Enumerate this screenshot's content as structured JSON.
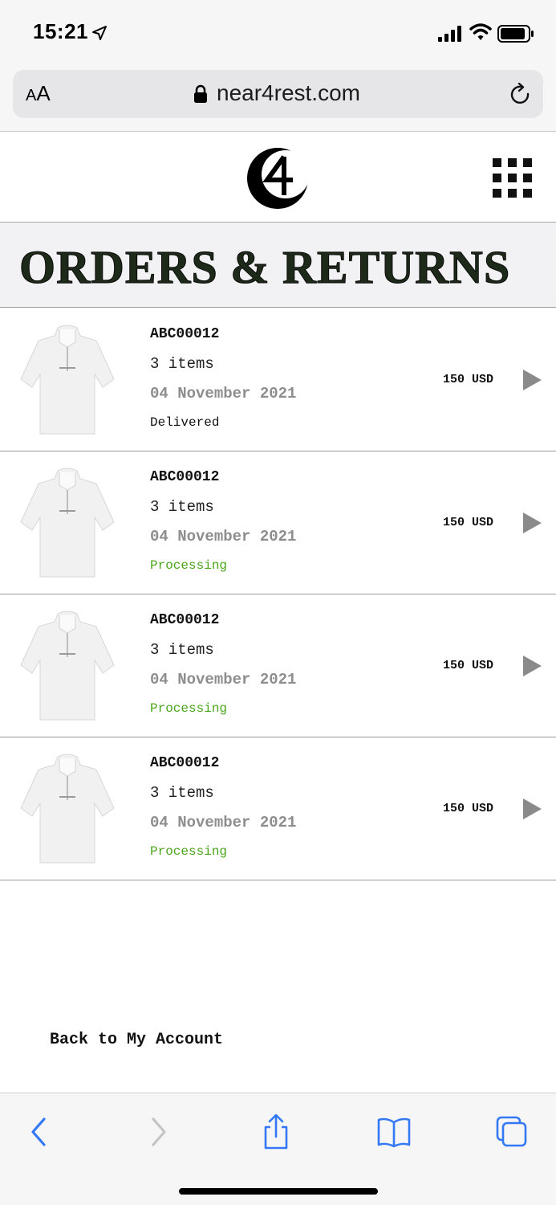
{
  "status_bar": {
    "time": "15:21",
    "icons": [
      "location-arrow-icon",
      "signal-bars-icon",
      "wifi-icon",
      "battery-icon"
    ]
  },
  "browser": {
    "text_size_label_small": "A",
    "text_size_label_large": "A",
    "url": "near4rest.com",
    "icons": [
      "lock-icon",
      "reload-icon"
    ]
  },
  "site_header": {
    "logo": "near4rest-logo-icon",
    "menu": "grid-menu-icon"
  },
  "page": {
    "title": "ORDERS & RETURNS"
  },
  "orders": [
    {
      "id": "ABC00012",
      "items": "3 items",
      "date": "04 November 2021",
      "status": "Delivered",
      "price": "150 USD"
    },
    {
      "id": "ABC00012",
      "items": "3 items",
      "date": "04 November 2021",
      "status": "Processing",
      "price": "150 USD"
    },
    {
      "id": "ABC00012",
      "items": "3 items",
      "date": "04 November 2021",
      "status": "Processing",
      "price": "150 USD"
    },
    {
      "id": "ABC00012",
      "items": "3 items",
      "date": "04 November 2021",
      "status": "Processing",
      "price": "150 USD"
    }
  ],
  "colors": {
    "status_processing": "#4aa51b",
    "status_delivered": "#111111",
    "date_gray": "#8e8e8e",
    "safari_blue": "#3478f6"
  },
  "back_link": {
    "label": "Back to My Account"
  },
  "toolbar": {
    "icons": [
      "back-chevron-icon",
      "forward-chevron-icon",
      "share-icon",
      "bookmarks-icon",
      "tabs-icon"
    ]
  }
}
